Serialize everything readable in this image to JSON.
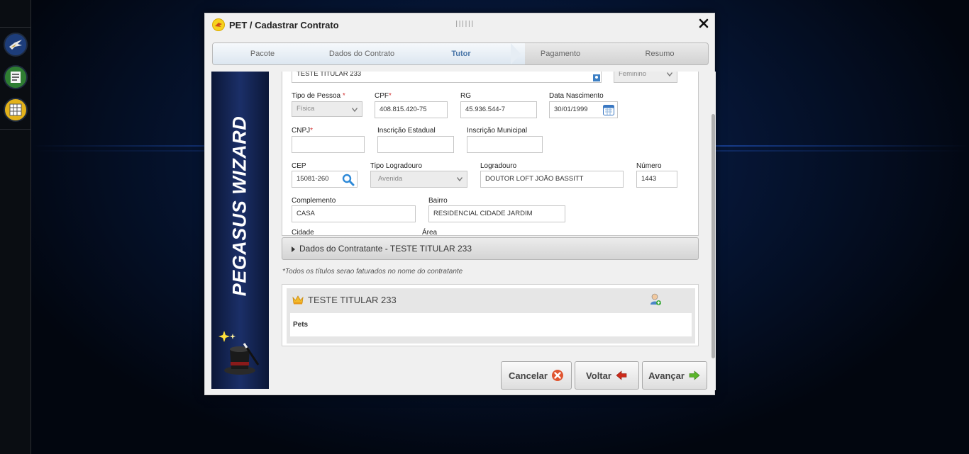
{
  "dialog": {
    "title": "PET / Cadastrar Contrato",
    "grip": "||||||"
  },
  "wizard": {
    "steps": [
      "Pacote",
      "Dados do Contrato",
      "Tutor",
      "Pagamento",
      "Resumo"
    ],
    "active_step": "Tutor",
    "banner_text": "PEGASUS WIZARD"
  },
  "form": {
    "nome_value": "TESTE TITULAR 233",
    "sexo_value": "Feminino",
    "tipo_pessoa": {
      "label": "Tipo de Pessoa",
      "required": "*",
      "value": "Física"
    },
    "cpf": {
      "label": "CPF",
      "required": "*",
      "value": "408.815.420-75"
    },
    "rg": {
      "label": "RG",
      "value": "45.936.544-7"
    },
    "data_nascimento": {
      "label": "Data Nascimento",
      "value": "30/01/1999"
    },
    "cnpj": {
      "label": "CNPJ",
      "required": "*",
      "value": ""
    },
    "inscricao_estadual": {
      "label": "Inscrição Estadual",
      "value": ""
    },
    "inscricao_municipal": {
      "label": "Inscrição Municipal",
      "value": ""
    },
    "cep": {
      "label": "CEP",
      "value": "15081-260"
    },
    "tipo_logradouro": {
      "label": "Tipo Logradouro",
      "value": "Avenida"
    },
    "logradouro": {
      "label": "Logradouro",
      "value": "DOUTOR LOFT JOÃO BASSITT"
    },
    "numero": {
      "label": "Número",
      "value": "1443"
    },
    "complemento": {
      "label": "Complemento",
      "value": "CASA"
    },
    "bairro": {
      "label": "Bairro",
      "value": "RESIDENCIAL CIDADE JARDIM"
    },
    "cidade": {
      "label": "Cidade"
    },
    "area": {
      "label": "Área"
    }
  },
  "contratante": {
    "accordion_label": "Dados do Contratante - TESTE TITULAR 233",
    "note": "*Todos os títulos serao faturados no nome do contratante"
  },
  "card": {
    "title": "TESTE TITULAR 233",
    "pets_label": "Pets"
  },
  "buttons": {
    "cancel": "Cancelar",
    "back": "Voltar",
    "next": "Avançar"
  },
  "colors": {
    "active_step": "#4a76a8",
    "banner": "#1b2f68",
    "required": "#d03030",
    "cancel_icon": "#e05530",
    "back_icon": "#cc2a1a",
    "next_icon": "#5ab52a"
  }
}
